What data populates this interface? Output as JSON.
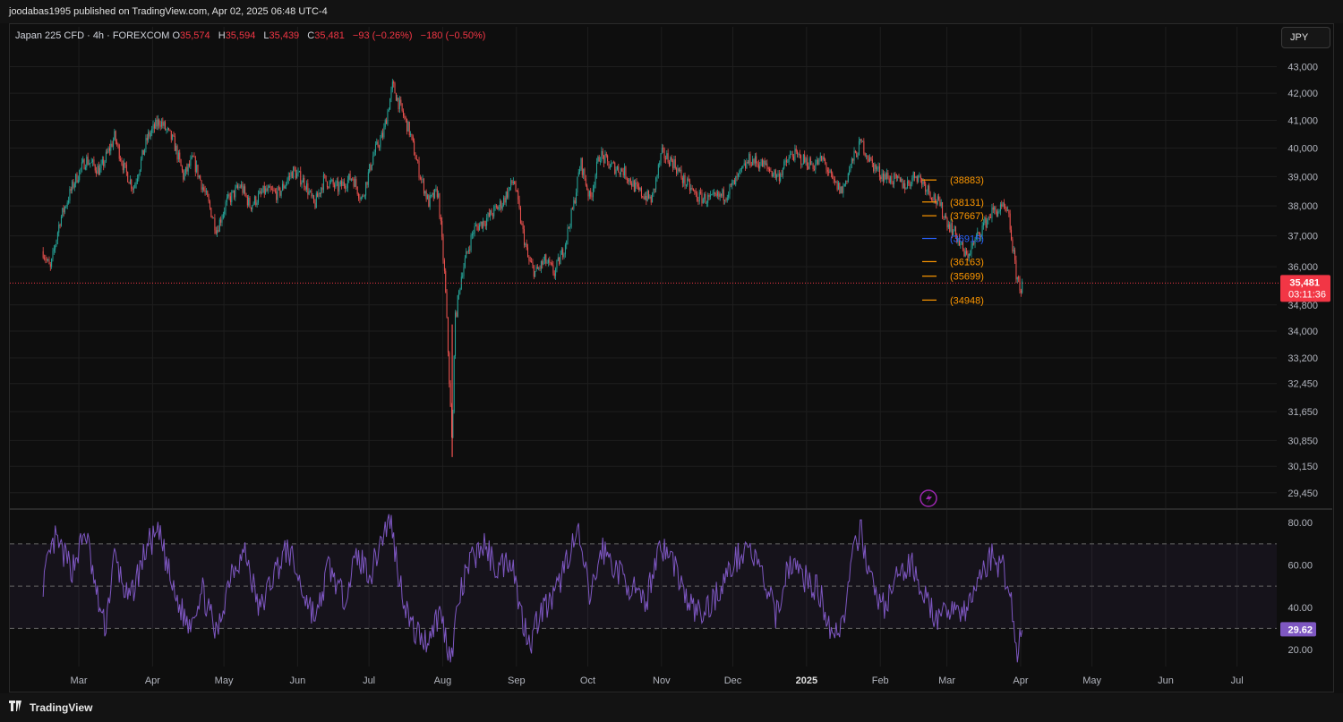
{
  "header": {
    "publish_line": "joodabas1995 published on TradingView.com, Apr 02, 2025 06:48 UTC-4"
  },
  "legend": {
    "symbol": "Japan 225 CFD · 4h · FOREXCOM",
    "open_label": "O",
    "open": "35,574",
    "high_label": "H",
    "high": "35,594",
    "low_label": "L",
    "low": "35,439",
    "close_label": "C",
    "close": "35,481",
    "change": "−93 (−0.26%)",
    "change2": "−180 (−0.50%)"
  },
  "currency_button": "JPY",
  "colors": {
    "up": "#26a69a",
    "down": "#ef5350",
    "last_price": "#f23645",
    "level": "#ff9800",
    "pivot": "#2962ff",
    "rsi": "#7e57c2",
    "grid": "#1e1e1e"
  },
  "footer": {
    "brand": "TradingView",
    "logo_icon": "tradingview-logo-icon"
  },
  "chart_data": [
    {
      "type": "candlestick",
      "title": "Japan 225 CFD · 4h · FOREXCOM",
      "x_tick_labels": [
        "Mar",
        "Apr",
        "May",
        "Jun",
        "Jul",
        "Aug",
        "Sep",
        "Oct",
        "Nov",
        "Dec",
        "2025",
        "Feb",
        "Mar",
        "Apr",
        "May",
        "Jun",
        "Jul"
      ],
      "y_tick_labels": [
        "43,000",
        "42,000",
        "41,000",
        "40,000",
        "39,000",
        "38,000",
        "37,000",
        "36,000",
        "34,800",
        "34,000",
        "33,200",
        "32,450",
        "31,650",
        "30,850",
        "30,150",
        "29,450"
      ],
      "y_ticks": [
        43000,
        42000,
        41000,
        40000,
        39000,
        38000,
        37000,
        36000,
        34800,
        34000,
        33200,
        32450,
        31650,
        30850,
        30150,
        29450
      ],
      "y_scale": "log",
      "ylim": [
        29050,
        43500
      ],
      "last_price": {
        "value": 35481,
        "label": "35,481",
        "countdown": "03:11:36"
      },
      "levels": [
        {
          "value": 38883,
          "label": "(38883)",
          "kind": "resistance"
        },
        {
          "value": 38131,
          "label": "(38131)",
          "kind": "resistance"
        },
        {
          "value": 37667,
          "label": "(37667)",
          "kind": "resistance"
        },
        {
          "value": 36915,
          "label": "(36915)",
          "kind": "pivot"
        },
        {
          "value": 36163,
          "label": "(36163)",
          "kind": "support"
        },
        {
          "value": 35699,
          "label": "(35699)",
          "kind": "support"
        },
        {
          "value": 34948,
          "label": "(34948)",
          "kind": "support"
        }
      ],
      "price_path": [
        [
          "2024-02-15",
          36500
        ],
        [
          "2024-02-18",
          35900
        ],
        [
          "2024-02-22",
          37500
        ],
        [
          "2024-02-28",
          38800
        ],
        [
          "2024-03-04",
          39600
        ],
        [
          "2024-03-10",
          39200
        ],
        [
          "2024-03-16",
          40400
        ],
        [
          "2024-03-20",
          39300
        ],
        [
          "2024-03-24",
          38600
        ],
        [
          "2024-03-30",
          40400
        ],
        [
          "2024-04-04",
          41000
        ],
        [
          "2024-04-10",
          40200
        ],
        [
          "2024-04-14",
          39000
        ],
        [
          "2024-04-18",
          39600
        ],
        [
          "2024-04-24",
          38200
        ],
        [
          "2024-04-28",
          37200
        ],
        [
          "2024-05-02",
          38100
        ],
        [
          "2024-05-08",
          38700
        ],
        [
          "2024-05-12",
          38000
        ],
        [
          "2024-05-18",
          38500
        ],
        [
          "2024-05-24",
          38400
        ],
        [
          "2024-05-30",
          39200
        ],
        [
          "2024-06-04",
          38800
        ],
        [
          "2024-06-08",
          38000
        ],
        [
          "2024-06-12",
          38900
        ],
        [
          "2024-06-18",
          38600
        ],
        [
          "2024-06-24",
          39000
        ],
        [
          "2024-06-28",
          38200
        ],
        [
          "2024-07-03",
          39800
        ],
        [
          "2024-07-07",
          40500
        ],
        [
          "2024-07-11",
          42300
        ],
        [
          "2024-07-14",
          41500
        ],
        [
          "2024-07-18",
          40600
        ],
        [
          "2024-07-22",
          39200
        ],
        [
          "2024-07-26",
          38100
        ],
        [
          "2024-07-30",
          38500
        ],
        [
          "2024-08-02",
          35500
        ],
        [
          "2024-08-05",
          30500
        ],
        [
          "2024-08-06",
          34200
        ],
        [
          "2024-08-09",
          35800
        ],
        [
          "2024-08-14",
          37200
        ],
        [
          "2024-08-20",
          37600
        ],
        [
          "2024-08-26",
          38100
        ],
        [
          "2024-08-31",
          38900
        ],
        [
          "2024-09-03",
          37400
        ],
        [
          "2024-09-06",
          36200
        ],
        [
          "2024-09-09",
          35800
        ],
        [
          "2024-09-13",
          36200
        ],
        [
          "2024-09-17",
          35800
        ],
        [
          "2024-09-21",
          36600
        ],
        [
          "2024-09-25",
          38000
        ],
        [
          "2024-09-28",
          39500
        ],
        [
          "2024-10-02",
          38200
        ],
        [
          "2024-10-06",
          39800
        ],
        [
          "2024-10-10",
          39400
        ],
        [
          "2024-10-16",
          39200
        ],
        [
          "2024-10-22",
          38500
        ],
        [
          "2024-10-28",
          38200
        ],
        [
          "2024-11-01",
          39800
        ],
        [
          "2024-11-06",
          39500
        ],
        [
          "2024-11-10",
          38900
        ],
        [
          "2024-11-16",
          38300
        ],
        [
          "2024-11-22",
          38200
        ],
        [
          "2024-11-28",
          38400
        ],
        [
          "2024-12-02",
          38800
        ],
        [
          "2024-12-08",
          39600
        ],
        [
          "2024-12-14",
          39400
        ],
        [
          "2024-12-20",
          39000
        ],
        [
          "2024-12-26",
          39800
        ],
        [
          "2024-12-30",
          39600
        ],
        [
          "2025-01-04",
          39400
        ],
        [
          "2025-01-08",
          39600
        ],
        [
          "2025-01-12",
          38800
        ],
        [
          "2025-01-16",
          38500
        ],
        [
          "2025-01-20",
          39500
        ],
        [
          "2025-01-24",
          40200
        ],
        [
          "2025-01-28",
          39500
        ],
        [
          "2025-02-01",
          39100
        ],
        [
          "2025-02-06",
          38900
        ],
        [
          "2025-02-12",
          38700
        ],
        [
          "2025-02-16",
          39100
        ],
        [
          "2025-02-20",
          38700
        ],
        [
          "2025-02-26",
          38000
        ],
        [
          "2025-03-01",
          37500
        ],
        [
          "2025-03-05",
          37000
        ],
        [
          "2025-03-09",
          36300
        ],
        [
          "2025-03-12",
          36700
        ],
        [
          "2025-03-16",
          37300
        ],
        [
          "2025-03-20",
          37800
        ],
        [
          "2025-03-25",
          37900
        ],
        [
          "2025-03-27",
          37600
        ],
        [
          "2025-03-30",
          35800
        ],
        [
          "2025-04-01",
          35300
        ],
        [
          "2025-04-02",
          35481
        ]
      ]
    },
    {
      "type": "line",
      "title": "",
      "series_name": "",
      "y_tick_labels": [
        "80.00",
        "60.00",
        "40.00",
        "20.00"
      ],
      "y_ticks": [
        80,
        60,
        40,
        20
      ],
      "ylim": [
        12,
        86
      ],
      "bands": [
        70,
        50,
        30
      ],
      "last_value": 29.62,
      "last_value_label": "29.62",
      "rsi_path": [
        [
          "2024-02-15",
          52
        ],
        [
          "2024-02-20",
          72
        ],
        [
          "2024-02-27",
          58
        ],
        [
          "2024-03-04",
          76
        ],
        [
          "2024-03-08",
          48
        ],
        [
          "2024-03-12",
          30
        ],
        [
          "2024-03-16",
          64
        ],
        [
          "2024-03-22",
          42
        ],
        [
          "2024-03-30",
          70
        ],
        [
          "2024-04-04",
          74
        ],
        [
          "2024-04-10",
          46
        ],
        [
          "2024-04-16",
          32
        ],
        [
          "2024-04-22",
          48
        ],
        [
          "2024-04-28",
          26
        ],
        [
          "2024-05-04",
          58
        ],
        [
          "2024-05-10",
          66
        ],
        [
          "2024-05-16",
          38
        ],
        [
          "2024-05-22",
          56
        ],
        [
          "2024-05-28",
          68
        ],
        [
          "2024-06-03",
          48
        ],
        [
          "2024-06-09",
          34
        ],
        [
          "2024-06-14",
          60
        ],
        [
          "2024-06-20",
          44
        ],
        [
          "2024-06-26",
          64
        ],
        [
          "2024-07-02",
          56
        ],
        [
          "2024-07-06",
          72
        ],
        [
          "2024-07-10",
          82
        ],
        [
          "2024-07-14",
          52
        ],
        [
          "2024-07-19",
          30
        ],
        [
          "2024-07-25",
          24
        ],
        [
          "2024-07-31",
          38
        ],
        [
          "2024-08-03",
          22
        ],
        [
          "2024-08-05",
          16
        ],
        [
          "2024-08-07",
          40
        ],
        [
          "2024-08-12",
          60
        ],
        [
          "2024-08-18",
          70
        ],
        [
          "2024-08-24",
          58
        ],
        [
          "2024-08-30",
          64
        ],
        [
          "2024-09-03",
          36
        ],
        [
          "2024-09-07",
          24
        ],
        [
          "2024-09-11",
          38
        ],
        [
          "2024-09-17",
          44
        ],
        [
          "2024-09-23",
          66
        ],
        [
          "2024-09-27",
          74
        ],
        [
          "2024-10-02",
          44
        ],
        [
          "2024-10-07",
          68
        ],
        [
          "2024-10-13",
          58
        ],
        [
          "2024-10-19",
          50
        ],
        [
          "2024-10-25",
          40
        ],
        [
          "2024-10-31",
          70
        ],
        [
          "2024-11-06",
          62
        ],
        [
          "2024-11-12",
          42
        ],
        [
          "2024-11-18",
          36
        ],
        [
          "2024-11-24",
          46
        ],
        [
          "2024-12-01",
          60
        ],
        [
          "2024-12-07",
          70
        ],
        [
          "2024-12-13",
          56
        ],
        [
          "2024-12-19",
          36
        ],
        [
          "2024-12-25",
          62
        ],
        [
          "2024-12-31",
          54
        ],
        [
          "2025-01-06",
          48
        ],
        [
          "2025-01-12",
          28
        ],
        [
          "2025-01-16",
          32
        ],
        [
          "2025-01-21",
          66
        ],
        [
          "2025-01-24",
          76
        ],
        [
          "2025-01-29",
          48
        ],
        [
          "2025-02-03",
          40
        ],
        [
          "2025-02-09",
          56
        ],
        [
          "2025-02-15",
          60
        ],
        [
          "2025-02-20",
          44
        ],
        [
          "2025-02-26",
          32
        ],
        [
          "2025-03-03",
          42
        ],
        [
          "2025-03-09",
          36
        ],
        [
          "2025-03-15",
          56
        ],
        [
          "2025-03-20",
          64
        ],
        [
          "2025-03-25",
          58
        ],
        [
          "2025-03-28",
          44
        ],
        [
          "2025-03-30",
          22
        ],
        [
          "2025-03-31",
          16
        ],
        [
          "2025-04-01",
          30
        ],
        [
          "2025-04-02",
          29.62
        ]
      ]
    }
  ]
}
